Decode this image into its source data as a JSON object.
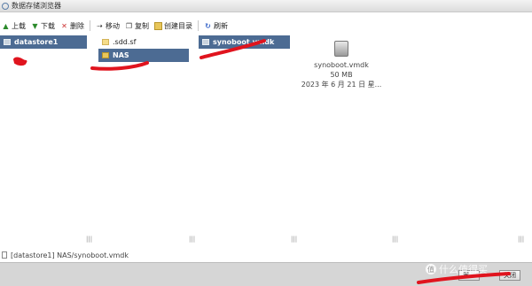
{
  "window": {
    "title": "数据存储浏览器"
  },
  "toolbar": {
    "buttons": [
      {
        "label": "上载",
        "icon": "upload-icon"
      },
      {
        "label": "下载",
        "icon": "download-icon"
      },
      {
        "label": "删除",
        "icon": "delete-icon"
      },
      {
        "label": "移动",
        "icon": "move-icon"
      },
      {
        "label": "复制",
        "icon": "copy-icon"
      },
      {
        "label": "创建目录",
        "icon": "folder-icon"
      },
      {
        "label": "刷新",
        "icon": "refresh-icon"
      }
    ]
  },
  "columns": {
    "datastores": [
      {
        "label": "datastore1",
        "selected": true
      }
    ],
    "folders": [
      {
        "label": ".sdd.sf",
        "selected": false
      },
      {
        "label": "NAS",
        "selected": true
      }
    ],
    "files": [
      {
        "label": "synoboot.vmdk",
        "selected": true
      }
    ]
  },
  "preview": {
    "name": "synoboot.vmdk",
    "size": "50 MB",
    "date": "2023 年 6 月 21 日 星..."
  },
  "column_dividers": [
    "|||",
    "|||",
    "|||",
    "|||",
    "|||"
  ],
  "pathbar": {
    "path": "[datastore1] NAS/synoboot.vmdk"
  },
  "footer": {
    "left_button": "置...",
    "right_button": "关闭"
  },
  "watermark": {
    "badge": "值",
    "text": "什么值得买"
  },
  "colors": {
    "selection": "#4c6b93",
    "annotation": "#e0141e"
  }
}
